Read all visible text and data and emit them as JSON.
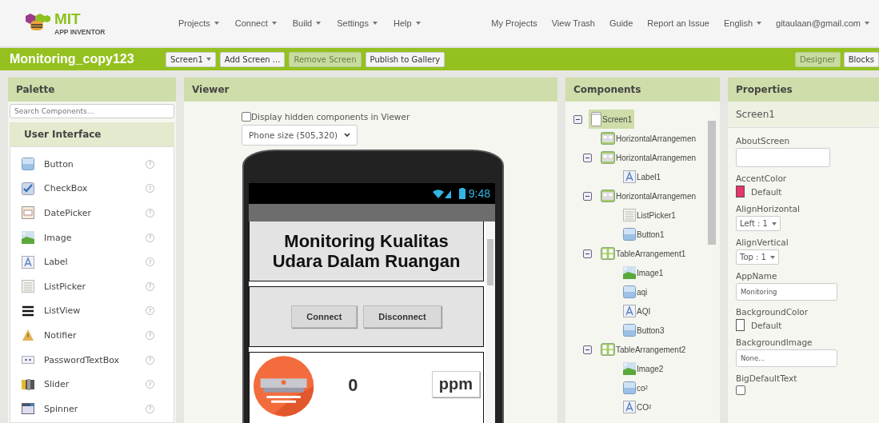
{
  "header": {
    "logo": {
      "title": "MIT",
      "subtitle": "APP INVENTOR"
    },
    "menus": [
      {
        "label": "Projects",
        "dropdown": true
      },
      {
        "label": "Connect",
        "dropdown": true
      },
      {
        "label": "Build",
        "dropdown": true
      },
      {
        "label": "Settings",
        "dropdown": true
      },
      {
        "label": "Help",
        "dropdown": true
      }
    ],
    "links": [
      {
        "label": "My Projects",
        "dropdown": false
      },
      {
        "label": "View Trash",
        "dropdown": false
      },
      {
        "label": "Guide",
        "dropdown": false
      },
      {
        "label": "Report an Issue",
        "dropdown": false
      },
      {
        "label": "English",
        "dropdown": true
      },
      {
        "label": "gitaulaan@gmail.com",
        "dropdown": true
      }
    ]
  },
  "project_bar": {
    "title": "Monitoring_copy123",
    "buttons": [
      {
        "label": "Screen1",
        "dropdown": true,
        "disabled": false
      },
      {
        "label": "Add Screen ...",
        "dropdown": false,
        "disabled": false
      },
      {
        "label": "Remove Screen",
        "dropdown": false,
        "disabled": true
      },
      {
        "label": "Publish to Gallery",
        "dropdown": false,
        "disabled": false
      }
    ],
    "views": [
      {
        "label": "Designer",
        "selected": true
      },
      {
        "label": "Blocks",
        "selected": false
      }
    ]
  },
  "palette": {
    "title": "Palette",
    "search": {
      "placeholder": "Search Components..."
    },
    "category": "User Interface",
    "items": [
      {
        "label": "Button",
        "kind": "button",
        "help": "?"
      },
      {
        "label": "CheckBox",
        "kind": "checkbox",
        "help": "?"
      },
      {
        "label": "DatePicker",
        "kind": "datepicker",
        "help": "?"
      },
      {
        "label": "Image",
        "kind": "image",
        "help": "?"
      },
      {
        "label": "Label",
        "kind": "label",
        "help": "?"
      },
      {
        "label": "ListPicker",
        "kind": "listpicker",
        "help": "?"
      },
      {
        "label": "ListView",
        "kind": "listview",
        "help": "?"
      },
      {
        "label": "Notifier",
        "kind": "notifier",
        "help": "?"
      },
      {
        "label": "PasswordTextBox",
        "kind": "password",
        "help": "?"
      },
      {
        "label": "Slider",
        "kind": "slider",
        "help": "?"
      },
      {
        "label": "Spinner",
        "kind": "spinner",
        "help": "?"
      }
    ]
  },
  "viewer": {
    "title": "Viewer",
    "hidden_components": {
      "label": "Display hidden components in Viewer",
      "checked": false
    },
    "phone_size": {
      "value": "Phone size (505,320)"
    },
    "phone": {
      "time": "9:48",
      "title_label": "Monitoring Kualitas Udara Dalam Ruangan",
      "buttons": [
        "Connect",
        "Disconnect"
      ],
      "reading": "0",
      "unit": "ppm"
    }
  },
  "components": {
    "title": "Components",
    "tree": [
      {
        "label": "Screen1",
        "kind": "screen",
        "selected": true,
        "expanded": true,
        "children": [
          {
            "label": "HorizontalArrangemen",
            "kind": "arrangement",
            "selected": false
          },
          {
            "label": "HorizontalArrangemen",
            "kind": "arrangement",
            "selected": false,
            "expanded": true,
            "children": [
              {
                "label": "Label1",
                "kind": "label",
                "selected": false
              }
            ]
          },
          {
            "label": "HorizontalArrangemen",
            "kind": "arrangement",
            "selected": false,
            "expanded": true,
            "children": [
              {
                "label": "ListPicker1",
                "kind": "listpicker",
                "selected": false
              },
              {
                "label": "Button1",
                "kind": "button",
                "selected": false
              }
            ]
          },
          {
            "label": "TableArrangement1",
            "kind": "table",
            "selected": false,
            "expanded": true,
            "children": [
              {
                "label": "Image1",
                "kind": "image",
                "selected": false
              },
              {
                "label": "aqi",
                "kind": "button",
                "selected": false
              },
              {
                "label": "AQI",
                "kind": "label",
                "selected": false
              },
              {
                "label": "Button3",
                "kind": "button",
                "selected": false
              }
            ]
          },
          {
            "label": "TableArrangement2",
            "kind": "table",
            "selected": false,
            "expanded": true,
            "children": [
              {
                "label": "Image2",
                "kind": "image",
                "selected": false
              },
              {
                "label": "co²",
                "kind": "button",
                "selected": false
              },
              {
                "label": "CO²",
                "kind": "label",
                "selected": false
              }
            ]
          }
        ]
      }
    ]
  },
  "properties": {
    "title": "Properties",
    "component": "Screen1",
    "items": [
      {
        "label": "AboutScreen",
        "kind": "textarea"
      },
      {
        "label": "AccentColor",
        "kind": "color",
        "value": "Default",
        "color": "#e8336b"
      },
      {
        "label": "AlignHorizontal",
        "kind": "dropdown",
        "value": "Left : 1"
      },
      {
        "label": "AlignVertical",
        "kind": "dropdown",
        "value": "Top : 1"
      },
      {
        "label": "AppName",
        "kind": "text",
        "value": "Monitoring"
      },
      {
        "label": "BackgroundColor",
        "kind": "color",
        "value": "Default",
        "color": "#ffffff"
      },
      {
        "label": "BackgroundImage",
        "kind": "text",
        "value": "None..."
      },
      {
        "label": "BigDefaultText",
        "kind": "checkbox",
        "checked": false
      }
    ]
  }
}
